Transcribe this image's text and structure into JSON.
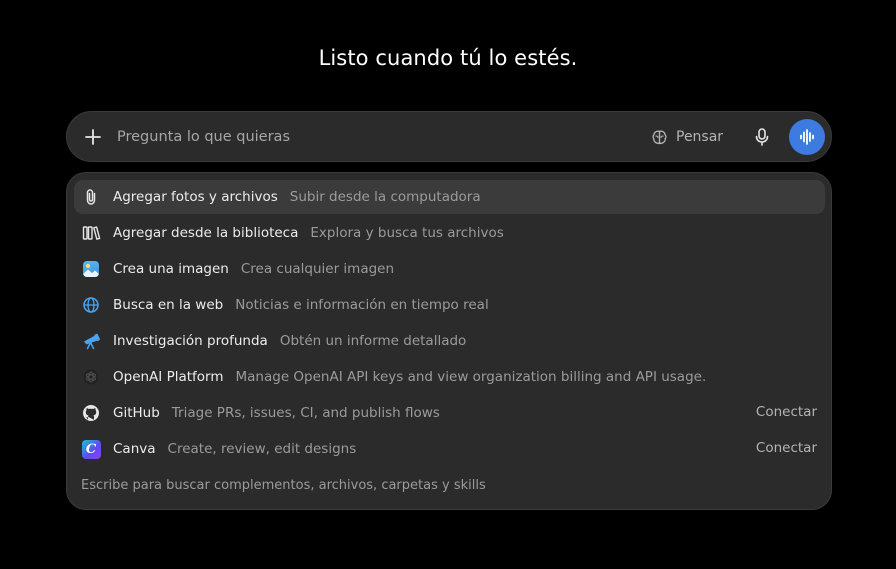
{
  "headline": "Listo cuando tú lo estés.",
  "composer": {
    "placeholder": "Pregunta lo que quieras",
    "think_label": "Pensar"
  },
  "menu": {
    "items": [
      {
        "title": "Agregar fotos y archivos",
        "description": "Subir desde la computadora",
        "icon": "paperclip-icon"
      },
      {
        "title": "Agregar desde la biblioteca",
        "description": "Explora y busca tus archivos",
        "icon": "library-icon"
      },
      {
        "title": "Crea una imagen",
        "description": "Crea cualquier imagen",
        "icon": "image-icon"
      },
      {
        "title": "Busca en la web",
        "description": "Noticias e información en tiempo real",
        "icon": "globe-icon"
      },
      {
        "title": "Investigación profunda",
        "description": "Obtén un informe detallado",
        "icon": "telescope-icon"
      },
      {
        "title": "OpenAI Platform",
        "description": "Manage OpenAI API keys and view organization billing and API usage.",
        "icon": "openai-icon"
      },
      {
        "title": "GitHub",
        "description": "Triage PRs, issues, CI, and publish flows",
        "icon": "github-icon",
        "action": "Conectar"
      },
      {
        "title": "Canva",
        "description": "Create, review, edit designs",
        "icon": "canva-icon",
        "action": "Conectar"
      }
    ],
    "hint": "Escribe para buscar complementos, archivos, carpetas y skills"
  },
  "colors": {
    "background": "#000000",
    "surface": "#2b2b2b",
    "active_row": "#3b3b3b",
    "accent": "#3d7be0"
  }
}
